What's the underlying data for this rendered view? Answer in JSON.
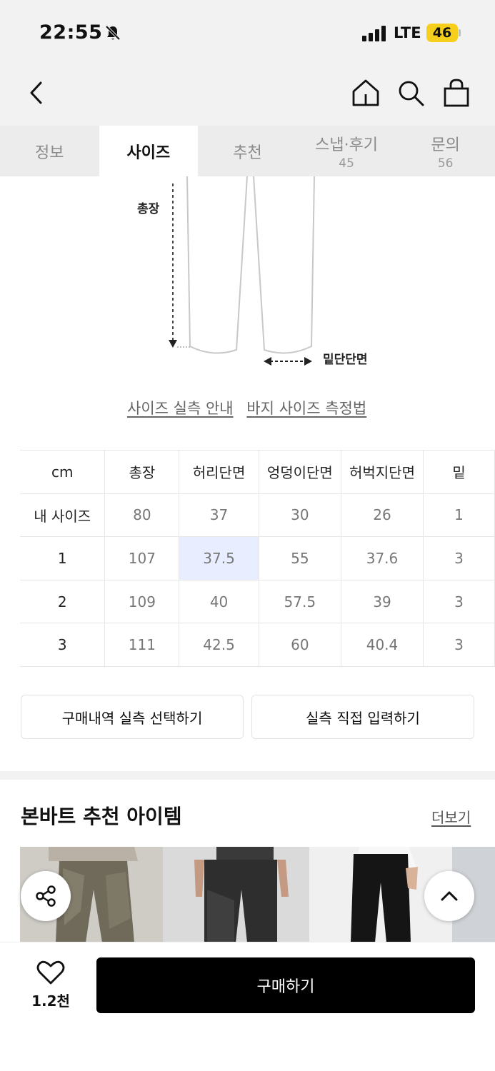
{
  "status_bar": {
    "time": "22:55",
    "network": "LTE",
    "battery": "46"
  },
  "tabs": [
    {
      "label": "정보",
      "count": ""
    },
    {
      "label": "사이즈",
      "count": ""
    },
    {
      "label": "추천",
      "count": ""
    },
    {
      "label": "스냅·후기",
      "count": "45"
    },
    {
      "label": "문의",
      "count": "56"
    }
  ],
  "active_tab": "사이즈",
  "diagram": {
    "length_label": "총장",
    "hem_label": "밑단단면"
  },
  "links": {
    "size_guide": "사이즈 실측 안내",
    "measure_guide": "바지 사이즈 측정법"
  },
  "size_table": {
    "headers": [
      "cm",
      "총장",
      "허리단면",
      "엉덩이단면",
      "허벅지단면",
      "밑"
    ],
    "rows": [
      [
        "내 사이즈",
        "80",
        "37",
        "30",
        "26",
        "1"
      ],
      [
        "1",
        "107",
        "37.5",
        "55",
        "37.6",
        "3"
      ],
      [
        "2",
        "109",
        "40",
        "57.5",
        "39",
        "3"
      ],
      [
        "3",
        "111",
        "42.5",
        "60",
        "40.4",
        "3"
      ]
    ],
    "highlight": {
      "row": 1,
      "col": 2,
      "color": "#e8eeff"
    }
  },
  "buttons": {
    "history": "구매내역 실측 선택하기",
    "direct": "실측 직접 입력하기"
  },
  "recommend": {
    "title": "본바트 추천 아이템",
    "more": "더보기"
  },
  "bottom": {
    "likes": "1.2천",
    "buy": "구매하기"
  },
  "icons": {
    "status": [
      "bell-off-icon",
      "signal-icon"
    ],
    "nav": [
      "back-icon",
      "home-icon",
      "search-icon",
      "bag-icon"
    ],
    "floating": [
      "share-icon",
      "chevron-up-icon"
    ],
    "bottom": [
      "heart-icon"
    ]
  },
  "colors": {
    "battery": "#f5cf1c",
    "buy_button": "#000000",
    "highlight_cell": "#e8eeff"
  }
}
